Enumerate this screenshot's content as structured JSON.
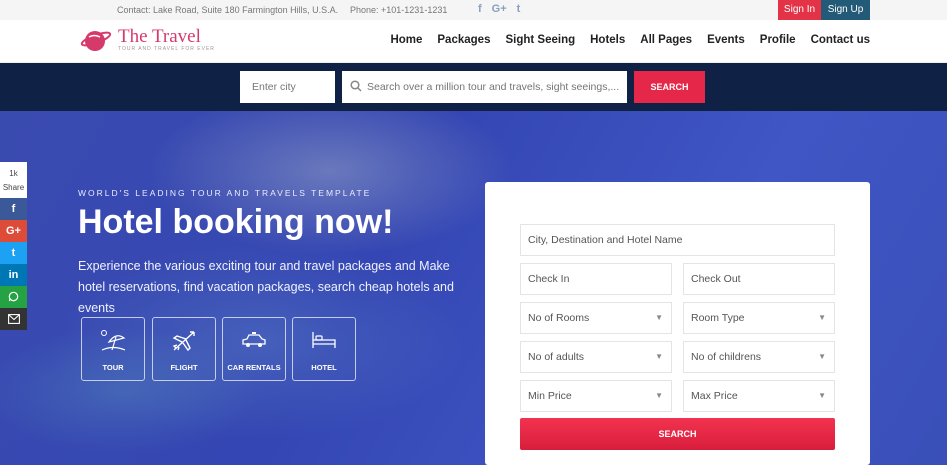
{
  "topbar": {
    "contact": "Contact: Lake Road, Suite 180 Farmington Hills, U.S.A.",
    "phone": "Phone: +101-1231-1231",
    "social": [
      "f",
      "G+",
      "t"
    ],
    "sign_in": "Sign In",
    "sign_up": "Sign Up"
  },
  "header": {
    "logo_title": "The Travel",
    "logo_tagline": "TOUR AND TRAVEL FOR EVER",
    "nav": [
      "Home",
      "Packages",
      "Sight Seeing",
      "Hotels",
      "All Pages",
      "Events",
      "Profile",
      "Contact us"
    ]
  },
  "search": {
    "city_placeholder": "Enter city",
    "main_placeholder": "Search over a million tour and travels, sight seeings,...",
    "button": "SEARCH"
  },
  "share": {
    "count": "1k",
    "label": "Share",
    "items": [
      "f",
      "G+",
      "t",
      "in",
      "wa",
      "mail"
    ]
  },
  "hero": {
    "subtitle": "WORLD'S LEADING TOUR AND TRAVELS TEMPLATE",
    "title": "Hotel booking now!",
    "description": "Experience the various exciting tour and travel packages and Make hotel reservations, find vacation packages, search cheap hotels and events",
    "categories": [
      "TOUR",
      "FLIGHT",
      "CAR RENTALS",
      "HOTEL"
    ]
  },
  "booking": {
    "destination": "City, Destination and Hotel Name",
    "check_in": "Check In",
    "check_out": "Check Out",
    "rooms": "No of Rooms",
    "room_type": "Room Type",
    "adults": "No of adults",
    "children": "No of childrens",
    "min_price": "Min Price",
    "max_price": "Max Price",
    "button": "SEARCH"
  },
  "colors": {
    "brand_red": "#e5284a",
    "navy": "#0f2245",
    "signup_blue": "#235a77",
    "hero_blue": "#3a4bb0"
  }
}
